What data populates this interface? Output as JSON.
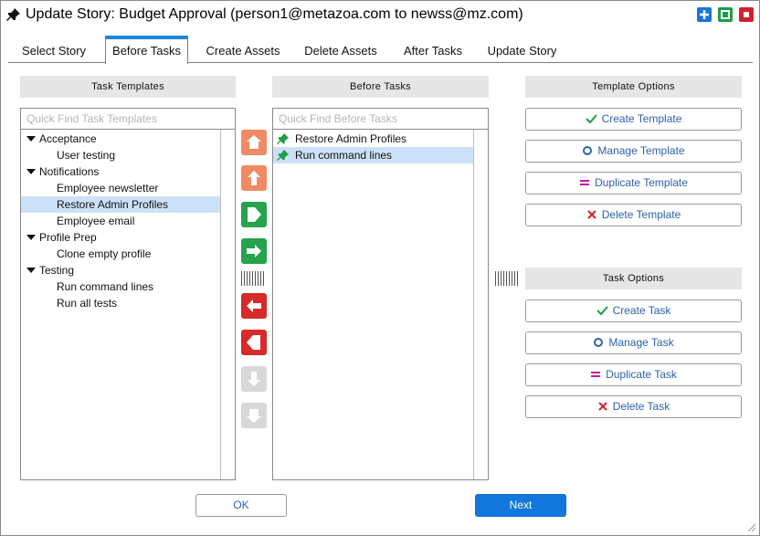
{
  "window": {
    "title": "Update Story: Budget Approval (person1@metazoa.com to newss@mz.com)",
    "title_icon": "pin-icon",
    "controls": [
      {
        "name": "add-icon",
        "color": "#1a73d9"
      },
      {
        "name": "maximize-icon",
        "color": "#1e9e43"
      },
      {
        "name": "close-icon",
        "color": "#d3202a"
      }
    ]
  },
  "tabs": [
    {
      "label": "Select Story",
      "active": false
    },
    {
      "label": "Before Tasks",
      "active": true
    },
    {
      "label": "Create Assets",
      "active": false
    },
    {
      "label": "Delete Assets",
      "active": false
    },
    {
      "label": "After Tasks",
      "active": false
    },
    {
      "label": "Update Story",
      "active": false
    }
  ],
  "task_templates": {
    "header": "Task Templates",
    "search_placeholder": "Quick Find Task Templates",
    "tree": [
      {
        "label": "Acceptance",
        "level": 0,
        "expanded": true
      },
      {
        "label": "User testing",
        "level": 1
      },
      {
        "label": "Notifications",
        "level": 0,
        "expanded": true
      },
      {
        "label": "Employee newsletter",
        "level": 1
      },
      {
        "label": "Restore Admin Profiles",
        "level": 1,
        "selected": true
      },
      {
        "label": "Employee email",
        "level": 1
      },
      {
        "label": "Profile Prep",
        "level": 0,
        "expanded": true
      },
      {
        "label": "Clone empty profile",
        "level": 1
      },
      {
        "label": "Testing",
        "level": 0,
        "expanded": true
      },
      {
        "label": "Run command lines",
        "level": 1
      },
      {
        "label": "Run all tests",
        "level": 1
      }
    ]
  },
  "before_tasks": {
    "header": "Before Tasks",
    "search_placeholder": "Quick Find Before Tasks",
    "items": [
      {
        "label": "Restore Admin Profiles",
        "icon": "green-pin-icon",
        "selected": false
      },
      {
        "label": "Run command lines",
        "icon": "green-pin-icon",
        "selected": true
      }
    ]
  },
  "move_buttons": [
    {
      "name": "move-to-top-button",
      "icon": "home-up-icon",
      "color": "#f08a62",
      "enabled": true
    },
    {
      "name": "move-up-button",
      "icon": "arrow-up-icon",
      "color": "#f08a62",
      "enabled": true
    },
    {
      "name": "add-task-button",
      "icon": "chevron-right-icon",
      "color": "#25a34d",
      "enabled": true
    },
    {
      "name": "add-all-button",
      "icon": "arrow-right-icon",
      "color": "#25a34d",
      "enabled": true
    },
    {
      "name": "remove-task-button",
      "icon": "arrow-left-icon",
      "color": "#d72a2a",
      "enabled": true
    },
    {
      "name": "remove-all-button",
      "icon": "chevron-left-icon",
      "color": "#d72a2a",
      "enabled": true
    },
    {
      "name": "move-down-button",
      "icon": "arrow-down-icon",
      "color": "#d8d8d8",
      "enabled": false
    },
    {
      "name": "move-to-bottom-button",
      "icon": "home-down-icon",
      "color": "#d8d8d8",
      "enabled": false
    }
  ],
  "template_options": {
    "header": "Template Options",
    "buttons": [
      {
        "label": "Create Template",
        "icon": "check-icon"
      },
      {
        "label": "Manage Template",
        "icon": "circle-icon"
      },
      {
        "label": "Duplicate Template",
        "icon": "equals-icon"
      },
      {
        "label": "Delete Template",
        "icon": "x-icon"
      }
    ]
  },
  "task_options": {
    "header": "Task Options",
    "buttons": [
      {
        "label": "Create Task",
        "icon": "check-icon"
      },
      {
        "label": "Manage Task",
        "icon": "circle-icon"
      },
      {
        "label": "Duplicate Task",
        "icon": "equals-icon"
      },
      {
        "label": "Delete Task",
        "icon": "x-icon"
      }
    ]
  },
  "footer": {
    "ok_label": "OK",
    "next_label": "Next"
  },
  "colors": {
    "accent": "#1f86d9",
    "link_text": "#2d62a8",
    "selection": "#cce1f7",
    "check": "#1e9e43",
    "circle": "#2d62a8",
    "equals": "#c21ca3",
    "delete": "#d3202a"
  }
}
